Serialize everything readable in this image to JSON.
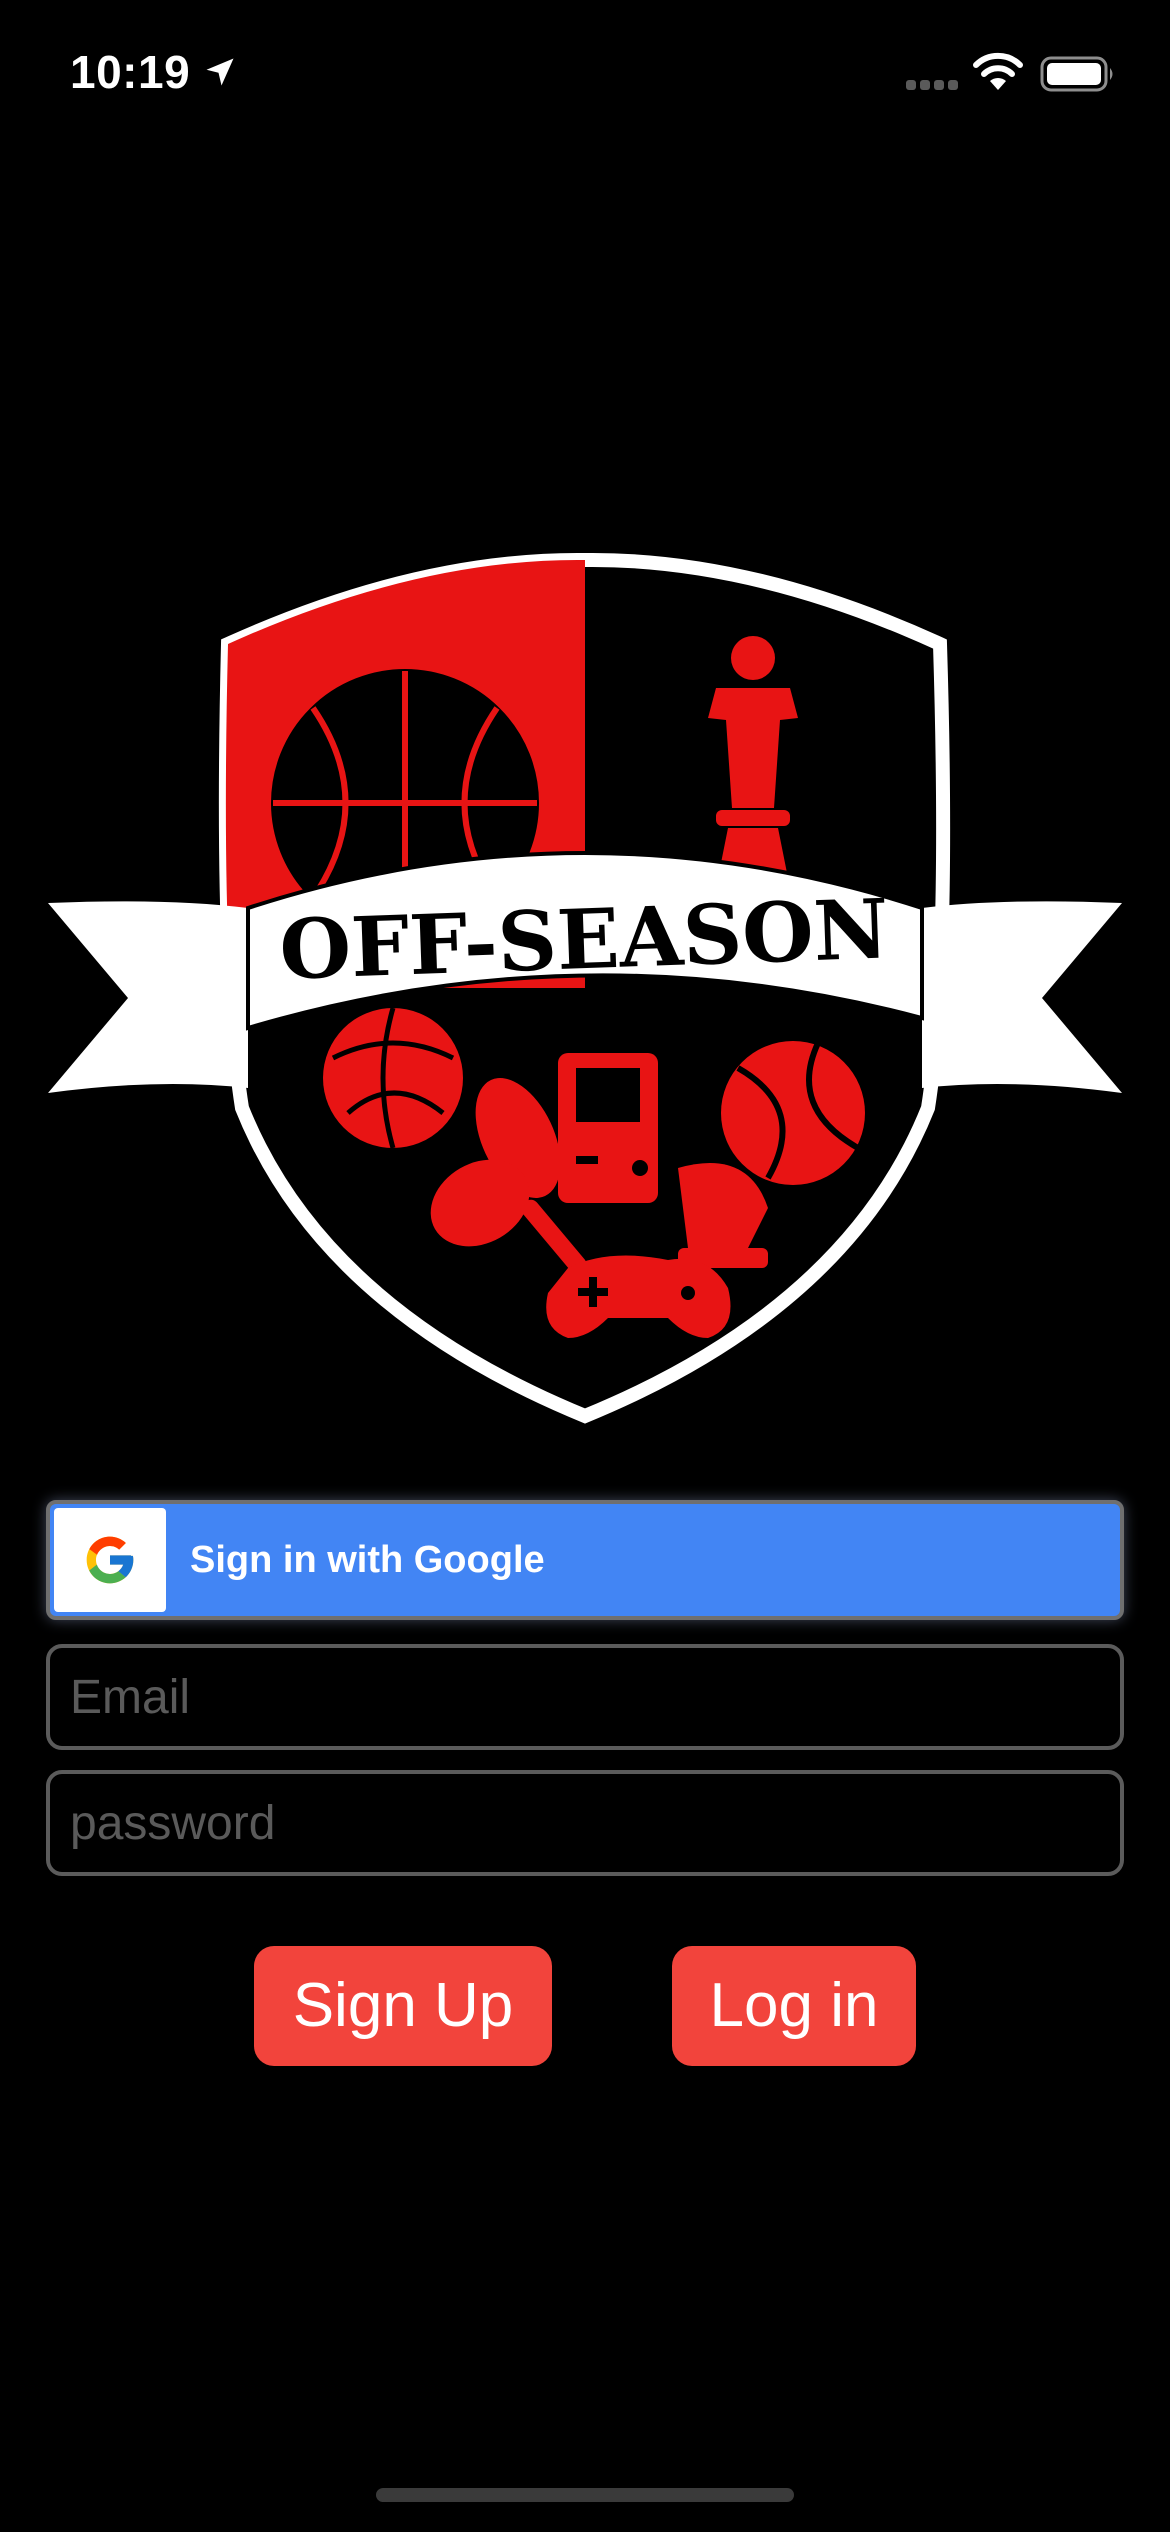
{
  "status_bar": {
    "time": "10:19",
    "icons": [
      "location-arrow-icon",
      "cellular-signal-icon",
      "wifi-icon",
      "battery-icon"
    ]
  },
  "logo": {
    "text": "OFF-SEASON",
    "colors": {
      "red": "#e81414",
      "black": "#000000",
      "white": "#ffffff"
    }
  },
  "google_button": {
    "label": "Sign in with Google",
    "background": "#4285f4"
  },
  "email": {
    "placeholder": "Email",
    "value": ""
  },
  "password": {
    "placeholder": "password",
    "value": ""
  },
  "buttons": {
    "signup_label": "Sign Up",
    "login_label": "Log in",
    "color": "#f2443c"
  }
}
